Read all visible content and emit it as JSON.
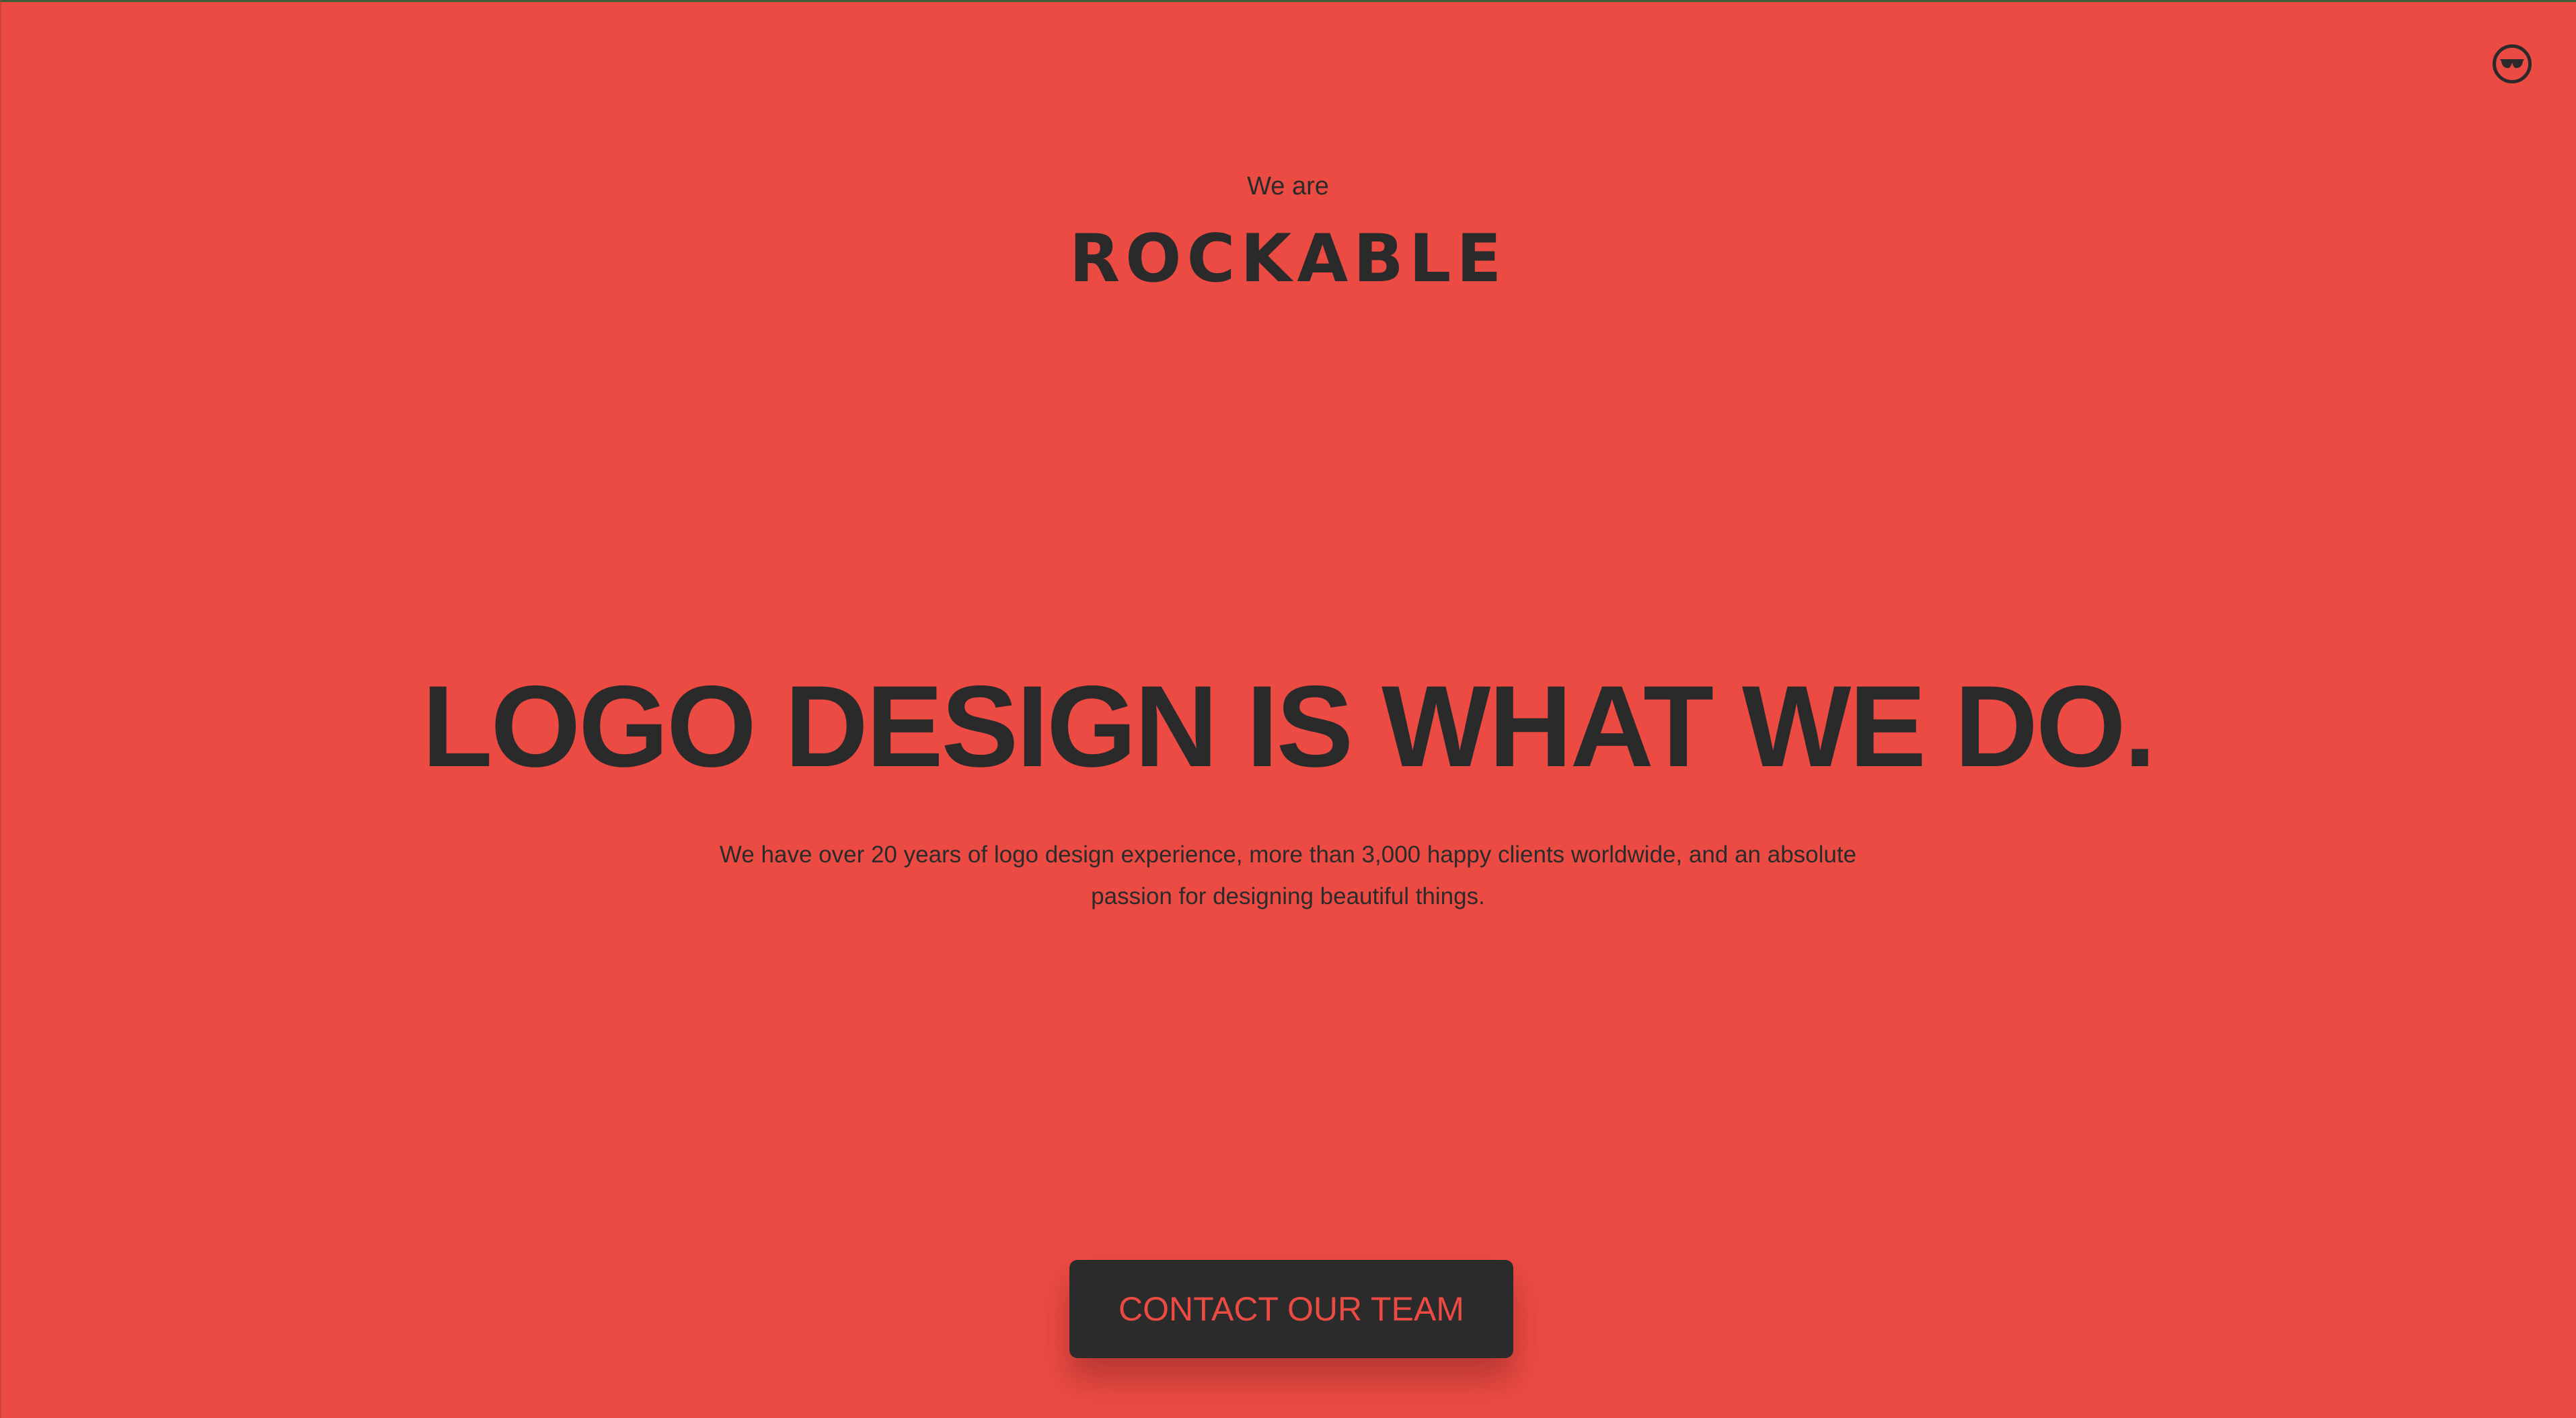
{
  "header": {
    "badge_icon": "sunglasses-icon"
  },
  "hero": {
    "eyebrow": "We are",
    "brand": "ROCKABLE",
    "headline": "LOGO DESIGN IS WHAT WE DO.",
    "lead": "We have over 20 years of logo design experience, more than 3,000 happy clients worldwide, and an absolute passion for designing beautiful things.",
    "cta_label": "CONTACT OUR TEAM"
  },
  "colors": {
    "background": "#ec4b43",
    "text": "#2b2b2b",
    "button_bg": "#2b2b2b",
    "button_text": "#ec4b43"
  }
}
